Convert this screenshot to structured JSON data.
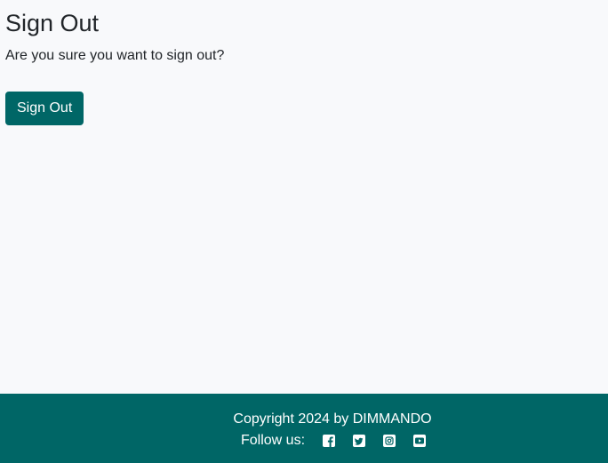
{
  "main": {
    "title": "Sign Out",
    "confirm_text": "Are you sure you want to sign out?",
    "signout_button_label": "Sign Out"
  },
  "footer": {
    "copyright": "Copyright 2024 by DIMMANDO",
    "follow_label": "Follow us:",
    "social_icons": [
      "facebook-icon",
      "twitter-icon",
      "instagram-icon",
      "youtube-icon"
    ]
  },
  "colors": {
    "brand": "#006666",
    "background": "#f8f9fb",
    "text": "#212529"
  }
}
